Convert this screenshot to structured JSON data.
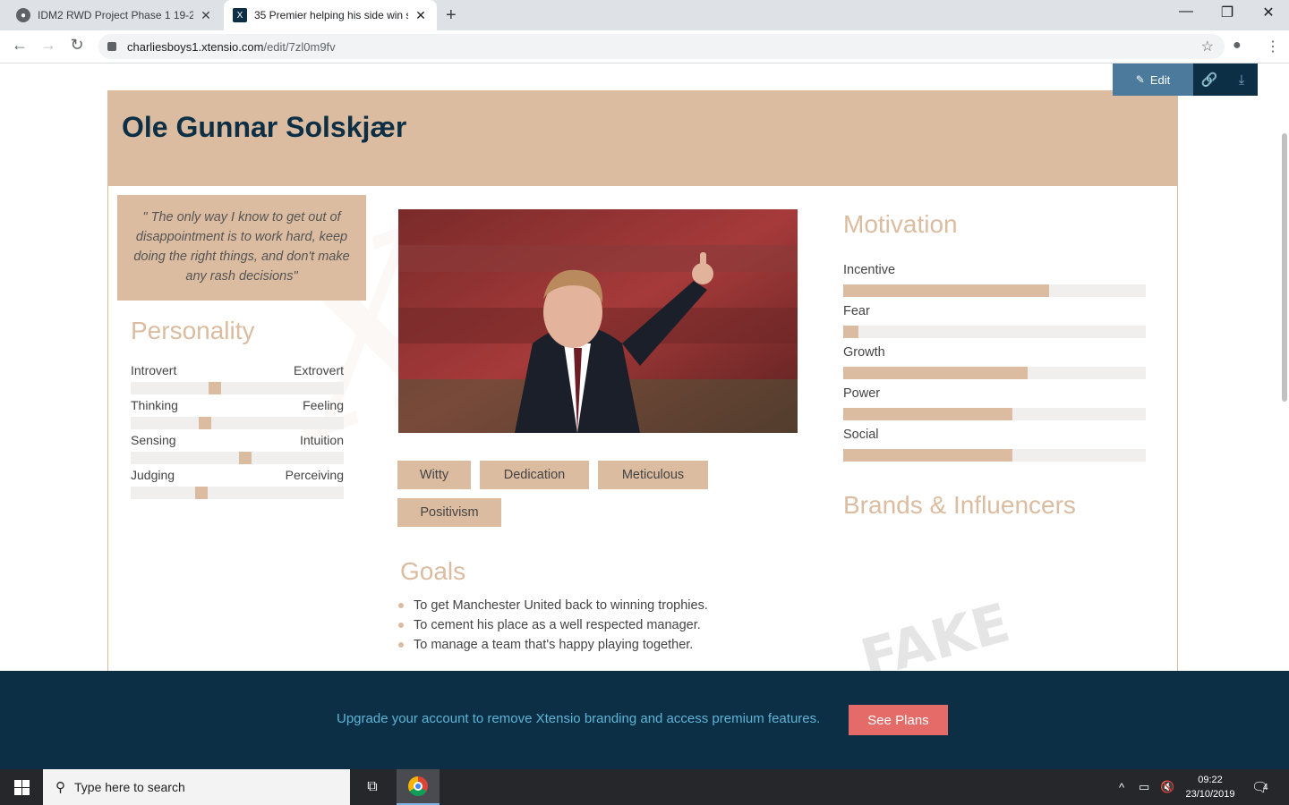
{
  "browser": {
    "tabs": [
      {
        "title": "IDM2 RWD Project Phase 1 19-20",
        "close": "✕"
      },
      {
        "title": "35 Premier helping his side win s",
        "close": "✕"
      }
    ],
    "new_tab": "+",
    "window_controls": [
      "—",
      "❐",
      "✕"
    ],
    "url_host": "charliesboys1.xtensio.com",
    "url_path": "/edit/7zl0m9fv",
    "icons": [
      "back-icon",
      "forward-icon",
      "reload-icon",
      "lock-icon",
      "star-icon",
      "account-icon",
      "menu-icon"
    ]
  },
  "toolbar": {
    "edit_label": "Edit"
  },
  "persona": {
    "name": "Ole Gunnar Solskjær",
    "quote": "\" The only way I know to get out of disappointment is to work hard, keep doing the right things, and don't make any rash decisions\"",
    "personality_title": "Personality",
    "personality": [
      {
        "left": "Introvert",
        "right": "Extrovert",
        "level": 0.39
      },
      {
        "left": "Thinking",
        "right": "Feeling",
        "level": 0.34
      },
      {
        "left": "Sensing",
        "right": "Intuition",
        "level": 0.54
      },
      {
        "left": "Judging",
        "right": "Perceiving",
        "level": 0.32
      }
    ],
    "tags": [
      "Witty",
      "Dedication",
      "Meticulous",
      "Positivism"
    ],
    "goals_title": "Goals",
    "goals": [
      "To get Manchester United back to winning trophies.",
      "To cement his place as a well respected manager.",
      "To manage a team that's happy playing together."
    ],
    "motivation_title": "Motivation",
    "motivation": [
      {
        "label": "Incentive",
        "level": 0.68
      },
      {
        "label": "Fear",
        "level": 0.05
      },
      {
        "label": "Growth",
        "level": 0.61
      },
      {
        "label": "Power",
        "level": 0.56
      },
      {
        "label": "Social",
        "level": 0.56
      }
    ],
    "brands_title": "Brands & Influencers"
  },
  "banner": {
    "text": "Upgrade your account to remove Xtensio branding and access premium features.",
    "button": "See Plans"
  },
  "taskbar": {
    "search_placeholder": "Type here to search",
    "time": "09:22",
    "date": "23/10/2019",
    "notifications": "4"
  },
  "colors": {
    "accent": "#dcbca0",
    "navy": "#0c2f45",
    "edit_blue": "#4b7a9c",
    "cta": "#e46b68"
  }
}
